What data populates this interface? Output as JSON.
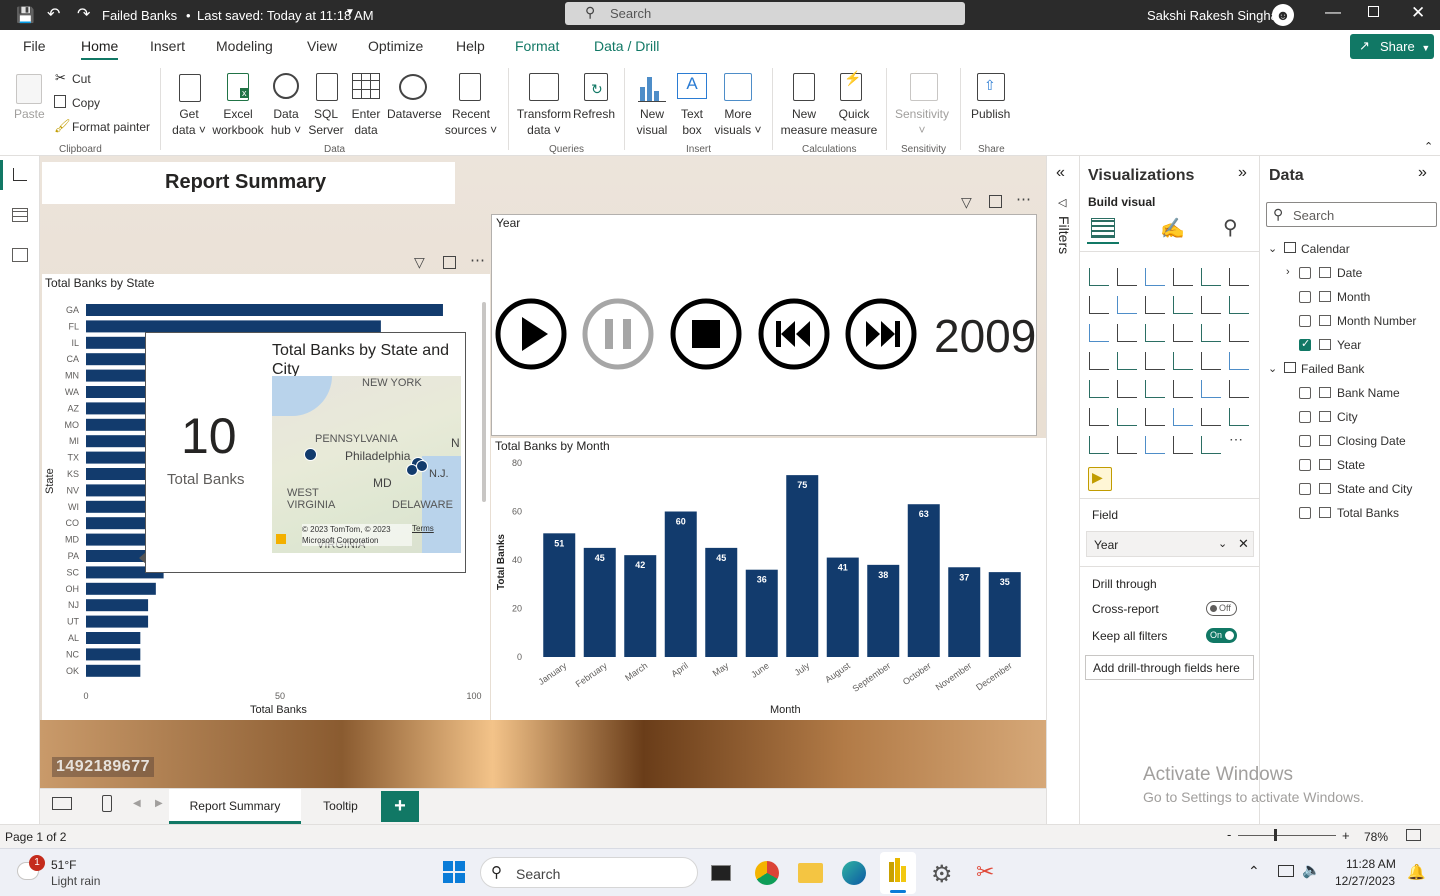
{
  "titlebar": {
    "doc_title": "Failed Banks",
    "saved": "Last saved: Today at 11:18 AM",
    "search": "Search",
    "user": "Sakshi Rakesh Singhal"
  },
  "menu": {
    "file": "File",
    "home": "Home",
    "insert": "Insert",
    "modeling": "Modeling",
    "view": "View",
    "optimize": "Optimize",
    "help": "Help",
    "format": "Format",
    "data_drill": "Data / Drill",
    "share": "Share"
  },
  "ribbon": {
    "paste": "Paste",
    "cut": "Cut",
    "copy": "Copy",
    "format_painter": "Format painter",
    "get_data": [
      "Get",
      "data"
    ],
    "excel": [
      "Excel",
      "workbook"
    ],
    "data_hub": [
      "Data",
      "hub"
    ],
    "sql": [
      "SQL",
      "Server"
    ],
    "enter": [
      "Enter",
      "data"
    ],
    "dataverse": "Dataverse",
    "recent": [
      "Recent",
      "sources"
    ],
    "transform": [
      "Transform",
      "data"
    ],
    "refresh": "Refresh",
    "new_visual": [
      "New",
      "visual"
    ],
    "text_box": [
      "Text",
      "box"
    ],
    "more_visuals": [
      "More",
      "visuals"
    ],
    "new_measure": [
      "New",
      "measure"
    ],
    "quick_measure": [
      "Quick",
      "measure"
    ],
    "sensitivity": "Sensitivity",
    "publish": "Publish",
    "groups": [
      "Clipboard",
      "Data",
      "Queries",
      "Insert",
      "Calculations",
      "Sensitivity",
      "Share"
    ]
  },
  "report": {
    "title": "Report Summary",
    "watermark_id": "1492189677",
    "year_slicer_title": "Year",
    "year_value": "2009"
  },
  "bar_chart": {
    "title": "Total Banks by State",
    "xlabel": "Total Banks",
    "ylabel": "State",
    "ticks": [
      "0",
      "50",
      "100"
    ]
  },
  "tooltip": {
    "title": "Total Banks by State and City",
    "card_value": "10",
    "card_label": "Total Banks",
    "map_labels": [
      "NEW YORK",
      "PENNSYLVANIA",
      "Philadelphia",
      "MD",
      "N.J.",
      "WEST VIRGINIA",
      "DELAWARE",
      "VIRGINIA",
      "N"
    ],
    "map_copyright": "© 2023 TomTom, © 2023 Microsoft Corporation",
    "map_terms": "Terms"
  },
  "month_chart": {
    "title": "Total Banks by Month",
    "xlabel": "Month",
    "ylabel": "Total Banks"
  },
  "chart_data": [
    {
      "type": "bar",
      "orientation": "horizontal",
      "title": "Total Banks by State",
      "xlabel": "Total Banks",
      "ylabel": "State",
      "categories": [
        "GA",
        "FL",
        "IL",
        "CA",
        "MN",
        "WA",
        "AZ",
        "MO",
        "MI",
        "TX",
        "KS",
        "NV",
        "WI",
        "CO",
        "MD",
        "PA",
        "SC",
        "OH",
        "NJ",
        "UT",
        "AL",
        "NC",
        "OK"
      ],
      "values": [
        92,
        76,
        57,
        48,
        38,
        35,
        33,
        31,
        28,
        26,
        24,
        24,
        22,
        20,
        20,
        20,
        20,
        18,
        16,
        16,
        14,
        14,
        14
      ],
      "xlim": [
        0,
        100
      ],
      "color": "#123b6d"
    },
    {
      "type": "bar",
      "title": "Total Banks by Month",
      "xlabel": "Month",
      "ylabel": "Total Banks",
      "categories": [
        "January",
        "February",
        "March",
        "April",
        "May",
        "June",
        "July",
        "August",
        "September",
        "October",
        "November",
        "December"
      ],
      "values": [
        51,
        45,
        42,
        60,
        45,
        36,
        75,
        41,
        38,
        63,
        37,
        35
      ],
      "ylim": [
        0,
        80
      ],
      "yticks": [
        "0",
        "20",
        "40",
        "60",
        "80"
      ],
      "color": "#123b6d"
    }
  ],
  "viz_pane": {
    "title": "Visualizations",
    "build_visual": "Build visual",
    "field_label": "Field",
    "field_value": "Year",
    "drill_through": "Drill through",
    "cross_report": "Cross-report",
    "cross_report_state": "Off",
    "keep_filters": "Keep all filters",
    "keep_filters_state": "On",
    "add_drill": "Add drill-through fields here"
  },
  "filters_label": "Filters",
  "data_pane": {
    "title": "Data",
    "search": "Search",
    "tables": [
      {
        "name": "Calendar",
        "fields": [
          {
            "name": "Date",
            "checked": false,
            "expand": true
          },
          {
            "name": "Month",
            "checked": false
          },
          {
            "name": "Month Number",
            "checked": false
          },
          {
            "name": "Year",
            "checked": true
          }
        ]
      },
      {
        "name": "Failed Bank",
        "fields": [
          {
            "name": "Bank Name",
            "checked": false
          },
          {
            "name": "City",
            "checked": false
          },
          {
            "name": "Closing Date",
            "checked": false
          },
          {
            "name": "State",
            "checked": false
          },
          {
            "name": "State and City",
            "checked": false
          },
          {
            "name": "Total Banks",
            "checked": false
          }
        ]
      }
    ]
  },
  "page_tabs": {
    "tab1": "Report Summary",
    "tab2": "Tooltip",
    "add": "+"
  },
  "status": {
    "page": "Page 1 of 2",
    "zoom": "78%"
  },
  "activate": {
    "line1": "Activate Windows",
    "line2": "Go to Settings to activate Windows."
  },
  "taskbar": {
    "weather_temp": "51°F",
    "weather_desc": "Light rain",
    "badge": "1",
    "search": "Search",
    "time": "11:28 AM",
    "date": "12/27/2023"
  },
  "colors": {
    "bar": "#123b6d",
    "accent": "#117865",
    "titlebar": "#2b2b2b"
  }
}
